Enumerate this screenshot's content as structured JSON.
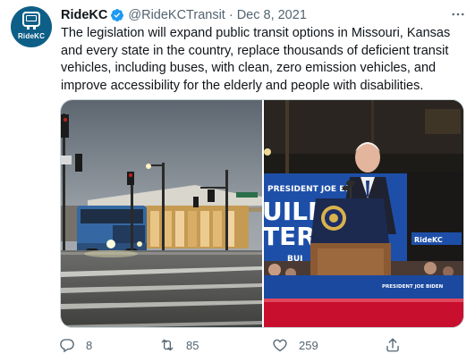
{
  "tweet": {
    "avatar_label": "RideKC",
    "display_name": "RideKC",
    "handle": "@RideKCTransit",
    "separator": "·",
    "date": "Dec 8, 2021",
    "text": "The legislation will expand public transit options in Missouri, Kansas and every state in the country, replace thousands of deficient transit vehicles, including buses, with clean, zero emission vehicles, and improve accessibility for the elderly and people with disabilities.",
    "media": {
      "photo_left_icon": "bus-station-photo",
      "photo_right_icon": "podium-speech-photo",
      "banner_text_1": "PRESIDENT JOE BIDEN",
      "banner_text_2": "UILD",
      "banner_text_3": "TER",
      "banner_text_4": "BUI",
      "banner_small": "PRESIDENT JOE BIDEN",
      "sign_text": "RideKC"
    },
    "actions": {
      "reply_count": "8",
      "retweet_count": "85",
      "like_count": "259"
    }
  },
  "colors": {
    "verified": "#1d9bf0",
    "icon_gray": "#536471",
    "avatar_bg": "#0e5f87"
  }
}
